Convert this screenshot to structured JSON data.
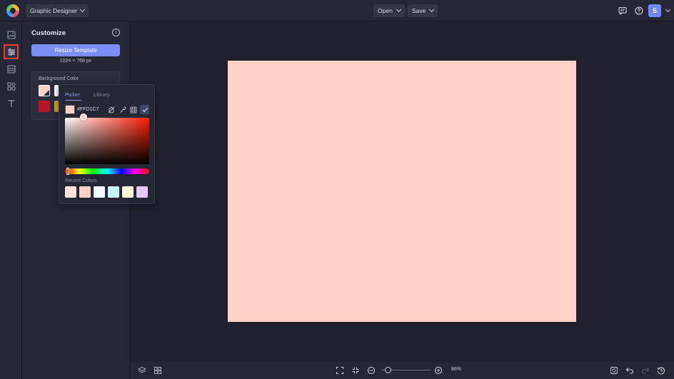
{
  "topbar": {
    "app_name": "Graphic Designer",
    "open_label": "Open",
    "save_label": "Save",
    "user_initial": "S",
    "accent_color": "#7287f7"
  },
  "rail": {
    "items": [
      "image-icon",
      "sliders-icon",
      "layout-icon",
      "elements-icon",
      "text-icon"
    ],
    "active_index": 1,
    "active_color": "#e8402b"
  },
  "customize": {
    "title": "Customize",
    "resize_label": "Resize Template",
    "canvas_size": "1024 × 768 px",
    "background_color_label": "Background Color",
    "swatches": [
      "#ffd1c7",
      "#ffffff",
      "#b41628",
      "#d4a12a"
    ]
  },
  "picker": {
    "tabs": [
      "Picker",
      "Library"
    ],
    "active_tab": "Picker",
    "hex_value": "#FFD1C7",
    "current_color": "#ffd1c7",
    "recent_label": "Recent Colors",
    "recent_colors": [
      "#fde3dd",
      "#ffd1c7",
      "#ecfafb",
      "#c8f7f9",
      "#fff7d6",
      "#e3c8f9"
    ]
  },
  "canvas": {
    "background": "#ffd1c7"
  },
  "bottombar": {
    "zoom_value": "86%"
  }
}
